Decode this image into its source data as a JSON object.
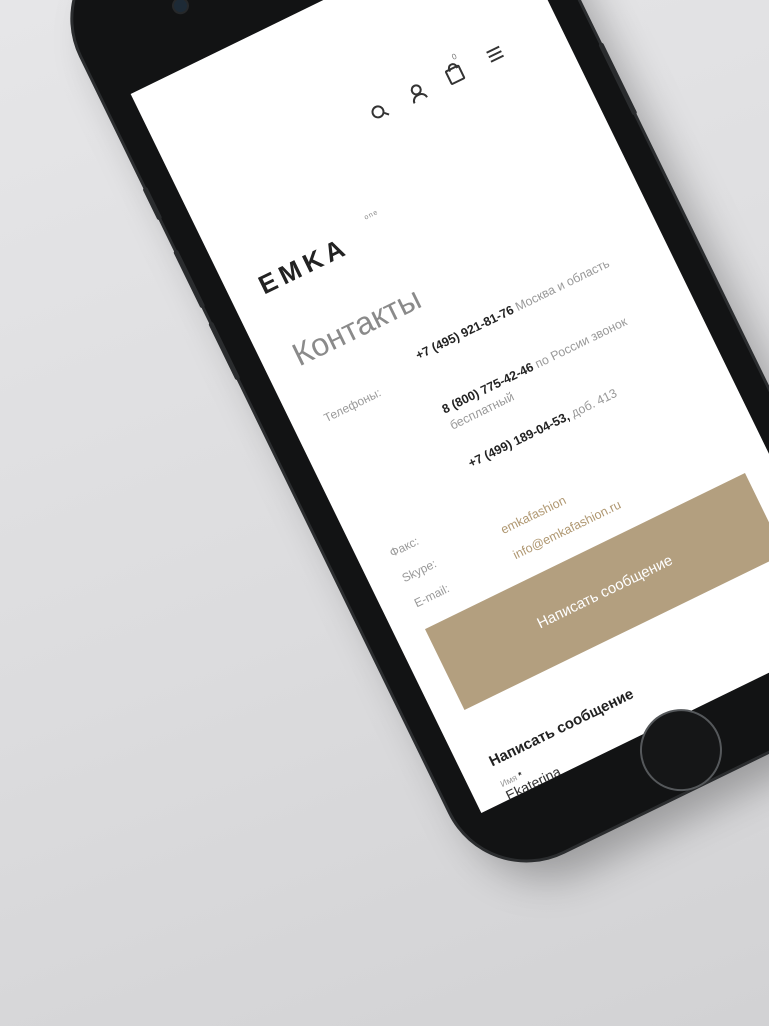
{
  "header": {
    "logo": "EMKA",
    "logo_sup": "one",
    "cart_count": "0",
    "icons": [
      "search-icon",
      "user-icon",
      "bag-icon",
      "menu-icon"
    ]
  },
  "page": {
    "title": "Контакты"
  },
  "contacts": {
    "phones_label": "Телефоны:",
    "phones": [
      {
        "number": "+7 (495) 921-81-76",
        "note": "Москва и область"
      },
      {
        "number": "8 (800) 775-42-46",
        "note": "по России звонок бесплатный"
      },
      {
        "number": "+7 (499) 189-04-53,",
        "note": "доб. 413"
      }
    ],
    "fax_label": "Факс:",
    "skype_label": "Skype:",
    "skype_value": "emkafashion",
    "email_label": "E-mail:",
    "email_value": "info@emkafashion.ru"
  },
  "actions": {
    "write_button": "Написать сообщение"
  },
  "form": {
    "title": "Написать сообщение",
    "name_label": "Имя",
    "required_mark": "*",
    "name_value": "Ekaterina"
  },
  "colors": {
    "accent": "#b39f7f",
    "link": "#b09872",
    "text": "#222222"
  }
}
